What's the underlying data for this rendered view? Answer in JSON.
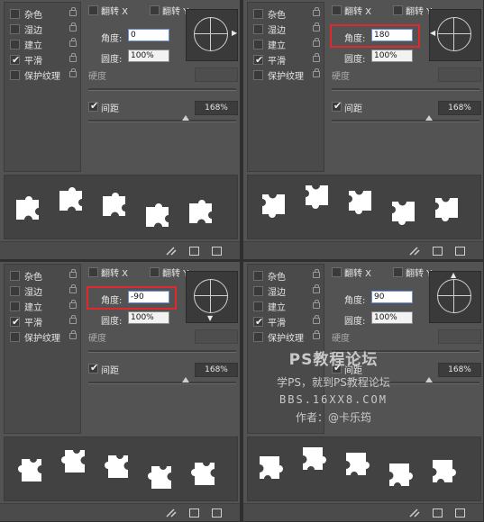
{
  "panels": [
    {
      "options": [
        {
          "label": "杂色",
          "checked": false
        },
        {
          "label": "湿边",
          "checked": false
        },
        {
          "label": "建立",
          "checked": false
        },
        {
          "label": "平滑",
          "checked": true
        },
        {
          "label": "保护纹理",
          "checked": false
        }
      ],
      "flip_x": "翻转 X",
      "flip_y": "翻转 Y",
      "angle_label": "角度:",
      "angle_value": "0",
      "roundness_label": "圆度:",
      "roundness_value": "100%",
      "hardness_label": "硬度",
      "spacing_label": "间距",
      "spacing_value": "168%",
      "preview_rotation_deg": 0,
      "highlighted": false
    },
    {
      "options": [
        {
          "label": "杂色",
          "checked": false
        },
        {
          "label": "湿边",
          "checked": false
        },
        {
          "label": "建立",
          "checked": false
        },
        {
          "label": "平滑",
          "checked": true
        },
        {
          "label": "保护纹理",
          "checked": false
        }
      ],
      "flip_x": "翻转 X",
      "flip_y": "翻转 Y",
      "angle_label": "角度:",
      "angle_value": "180",
      "roundness_label": "圆度:",
      "roundness_value": "100%",
      "hardness_label": "硬度",
      "spacing_label": "间距",
      "spacing_value": "168%",
      "preview_rotation_deg": 180,
      "highlighted": true
    },
    {
      "options": [
        {
          "label": "杂色",
          "checked": false
        },
        {
          "label": "湿边",
          "checked": false
        },
        {
          "label": "建立",
          "checked": false
        },
        {
          "label": "平滑",
          "checked": true
        },
        {
          "label": "保护纹理",
          "checked": false
        }
      ],
      "flip_x": "翻转 X",
      "flip_y": "翻转 Y",
      "angle_label": "角度:",
      "angle_value": "-90",
      "roundness_label": "圆度:",
      "roundness_value": "100%",
      "hardness_label": "硬度",
      "spacing_label": "间距",
      "spacing_value": "168%",
      "preview_rotation_deg": -90,
      "highlighted": true
    },
    {
      "options": [
        {
          "label": "杂色",
          "checked": false
        },
        {
          "label": "湿边",
          "checked": false
        },
        {
          "label": "建立",
          "checked": false
        },
        {
          "label": "平滑",
          "checked": true
        },
        {
          "label": "保护纹理",
          "checked": false
        }
      ],
      "flip_x": "翻转 X",
      "flip_y": "翻转 Y",
      "angle_label": "角度:",
      "angle_value": "90",
      "roundness_label": "圆度:",
      "roundness_value": "100%",
      "hardness_label": "硬度",
      "spacing_label": "间距",
      "spacing_value": "168%",
      "preview_rotation_deg": 90,
      "highlighted": false
    }
  ],
  "watermark": {
    "title": "PS教程论坛",
    "line2": "学PS，就到PS教程论坛",
    "line3": "BBS.16XX8.COM",
    "line4": "作者：@卡乐筠"
  },
  "colors": {
    "highlight": "#e0292e",
    "panel": "#535353",
    "piece": "#ffffff"
  }
}
